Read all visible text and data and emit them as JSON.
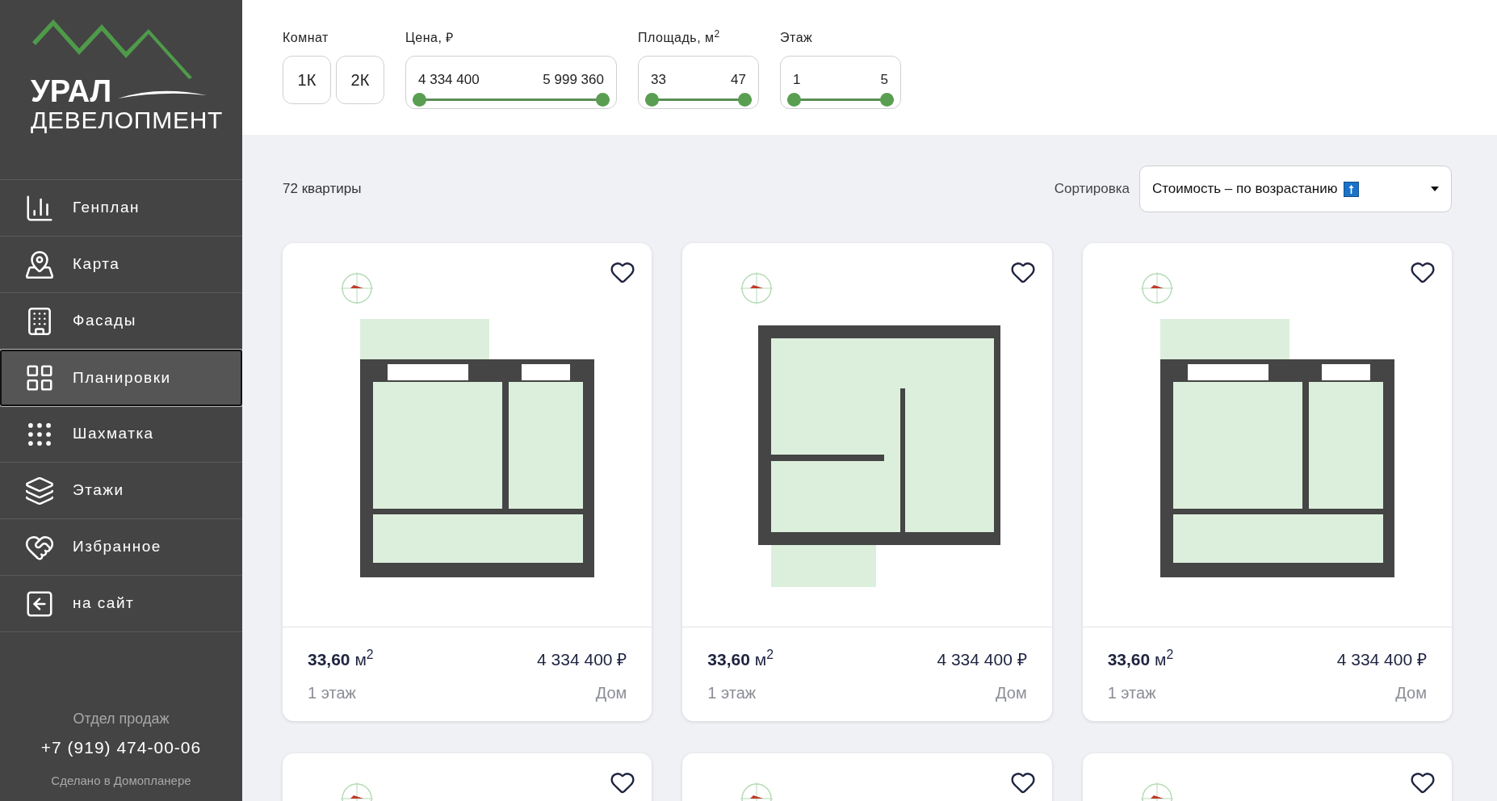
{
  "logo": {
    "line1": "УРАЛ",
    "line2": "ДЕВЕЛОПМЕНТ"
  },
  "nav": [
    {
      "label": "Генплан",
      "selected": false
    },
    {
      "label": "Карта",
      "selected": false
    },
    {
      "label": "Фасады",
      "selected": false
    },
    {
      "label": "Планировки",
      "selected": true
    },
    {
      "label": "Шахматка",
      "selected": false
    },
    {
      "label": "Этажи",
      "selected": false
    },
    {
      "label": "Избранное",
      "selected": false
    },
    {
      "label": "на сайт",
      "selected": false
    }
  ],
  "contact": {
    "title": "Отдел продаж",
    "phone": "+7 (919) 474-00-06",
    "credit": "Сделано в Домопланере"
  },
  "filters": {
    "rooms": {
      "label": "Комнат",
      "options": [
        {
          "label": "1К",
          "selected": false
        },
        {
          "label": "2К",
          "selected": false
        }
      ]
    },
    "ranges": [
      {
        "label": "Цена, ₽",
        "min": "4 334 400",
        "max": "5 999 360",
        "thumbs": [
          {
            "level": 0
          },
          {
            "level": 1
          }
        ]
      },
      {
        "label": "Площадь, м$^{2}$",
        "min": "33",
        "max": "47",
        "thumbs": [
          {
            "level": 0
          },
          {
            "level": 1
          }
        ]
      },
      {
        "label": "Этаж",
        "min": "1",
        "max": "5",
        "thumbs": [
          {
            "level": 0
          },
          {
            "level": 1
          }
        ]
      }
    ]
  },
  "count": "72 квартиры",
  "sort": {
    "label": "Сортировка",
    "value": "Стоимость – по возрастанию"
  },
  "cards": [
    {
      "favorite": false,
      "area": "33,60",
      "unit": "м$^{2}$",
      "price": "4 334 400 ₽",
      "floor": "1 этаж",
      "building": "Дом"
    },
    {
      "favorite": false,
      "area": "33,60",
      "unit": "м$^{2}$",
      "price": "4 334 400 ₽",
      "floor": "1 этаж",
      "building": "Дом"
    },
    {
      "favorite": false,
      "area": "33,60",
      "unit": "м$^{2}$",
      "price": "4 334 400 ₽",
      "floor": "1 этаж",
      "building": "Дом"
    },
    {
      "favorite": false
    },
    {
      "favorite": false
    },
    {
      "favorite": false
    }
  ]
}
